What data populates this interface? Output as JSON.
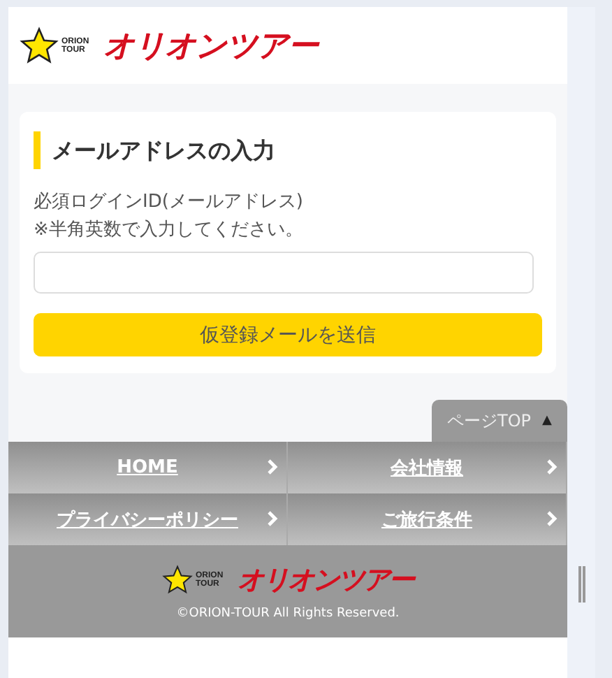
{
  "header": {
    "logo": {
      "tag": "ORION TOUR",
      "brand": "オリオンツアー"
    }
  },
  "form": {
    "heading": "メールアドレスの入力",
    "label_lines": [
      "必須ログインID(メールアドレス)",
      "※半角英数で入力してください。"
    ],
    "submit": "仮登録メールを送信"
  },
  "page_top": {
    "label": "ページTOP",
    "arrow": "▲"
  },
  "footer_nav": [
    {
      "label": "HOME"
    },
    {
      "label": "会社情報"
    },
    {
      "label": "プライバシーポリシー"
    },
    {
      "label": "ご旅行条件"
    }
  ],
  "footer": {
    "logo": {
      "tag": "ORION TOUR",
      "brand": "オリオンツアー"
    },
    "copyright": "©ORION-TOUR All Rights Reserved."
  }
}
